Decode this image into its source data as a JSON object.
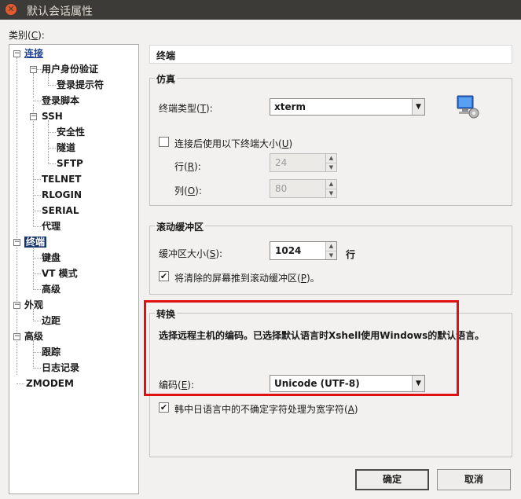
{
  "window": {
    "title": "默认会话属性",
    "close_glyph": "✕"
  },
  "sidebar": {
    "category_label_pre": "类别(",
    "category_label_key": "C",
    "category_label_post": "):",
    "items": [
      {
        "label": "连接",
        "toggle": "−"
      },
      {
        "label": "用户身份验证",
        "toggle": "−"
      },
      {
        "label": "登录提示符"
      },
      {
        "label": "登录脚本"
      },
      {
        "label": "SSH",
        "toggle": "−"
      },
      {
        "label": "安全性"
      },
      {
        "label": "隧道"
      },
      {
        "label": "SFTP"
      },
      {
        "label": "TELNET"
      },
      {
        "label": "RLOGIN"
      },
      {
        "label": "SERIAL"
      },
      {
        "label": "代理"
      },
      {
        "label": "终端",
        "toggle": "−"
      },
      {
        "label": "键盘"
      },
      {
        "label": "VT 模式"
      },
      {
        "label": "高级"
      },
      {
        "label": "外观",
        "toggle": "−"
      },
      {
        "label": "边距"
      },
      {
        "label": "高级",
        "toggle": "−"
      },
      {
        "label": "跟踪"
      },
      {
        "label": "日志记录"
      },
      {
        "label": "ZMODEM"
      }
    ]
  },
  "main": {
    "header": "终端",
    "emulation": {
      "group_title": "仿真",
      "terminal_type_label_pre": "终端类型(",
      "terminal_type_label_key": "T",
      "terminal_type_label_post": "):",
      "terminal_type_value": "xterm",
      "use_size_label_pre": "连接后使用以下终端大小(",
      "use_size_label_key": "U",
      "use_size_label_post": ")",
      "use_size_checked": false,
      "rows_label_pre": "行(",
      "rows_label_key": "R",
      "rows_label_post": "):",
      "rows_value": "24",
      "cols_label_pre": "列(",
      "cols_label_key": "O",
      "cols_label_post": "):",
      "cols_value": "80"
    },
    "scroll": {
      "group_title": "滚动缓冲区",
      "buffer_label_pre": "缓冲区大小(",
      "buffer_label_key": "S",
      "buffer_label_post": "):",
      "buffer_value": "1024",
      "buffer_unit": "行",
      "push_label_pre": "将清除的屏幕推到滚动缓冲区(",
      "push_label_key": "P",
      "push_label_post": ")。",
      "push_checked": true,
      "check_glyph": "✔"
    },
    "conversion": {
      "group_title": "转换",
      "description": "选择远程主机的编码。已选择默认语言时Xshell使用Windows的默认语言。",
      "encoding_label_pre": "编码(",
      "encoding_label_key": "E",
      "encoding_label_post": "):",
      "encoding_value": "Unicode (UTF-8)",
      "cjk_label_pre": "韩中日语言中的不确定字符处理为宽字符(",
      "cjk_label_key": "A",
      "cjk_label_post": ")",
      "cjk_checked": true
    }
  },
  "footer": {
    "ok_label": "确定",
    "cancel_label": "取消"
  },
  "glyphs": {
    "dropdown": "▼",
    "up": "▲",
    "down": "▼"
  },
  "colors": {
    "highlight": "#e01010",
    "selection": "#16336e"
  }
}
